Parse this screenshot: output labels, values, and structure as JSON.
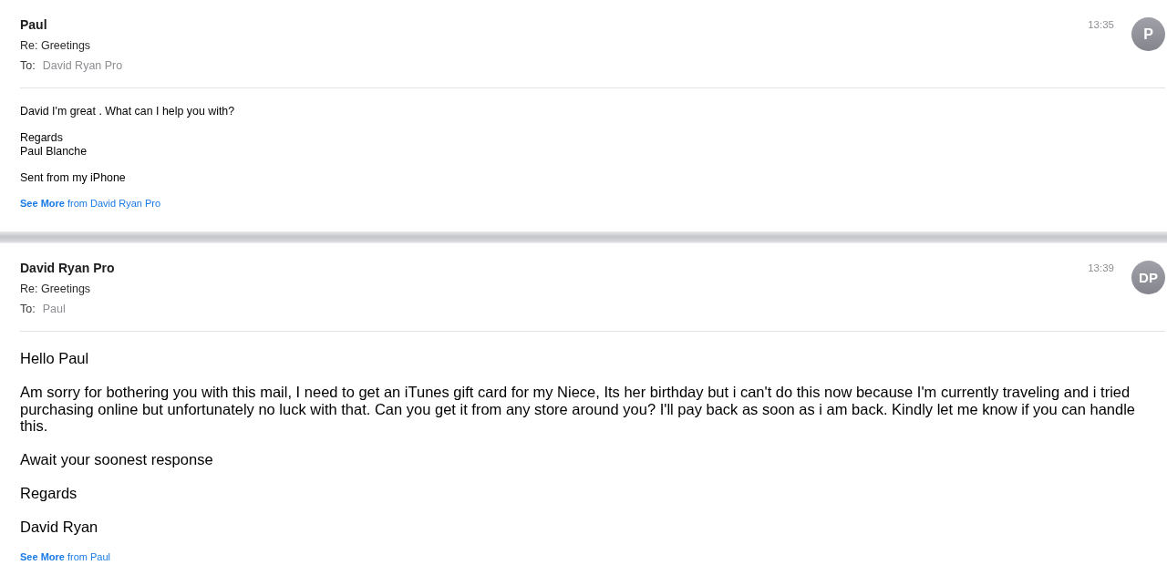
{
  "messages": [
    {
      "kind": "reply",
      "sender": "Paul",
      "subject": "Re: Greetings",
      "to_label": "To:",
      "recipient": "David Ryan Pro",
      "time": "13:35",
      "avatar_initials": "P",
      "body": [
        [
          "David I'm great . What can I help you with?"
        ],
        [
          "Regards",
          "Paul Blanche"
        ],
        [
          "Sent from my iPhone"
        ]
      ],
      "see_more": "**See More** from David Ryan Pro"
    },
    {
      "kind": "original",
      "sender": "David Ryan Pro",
      "subject": "Re: Greetings",
      "to_label": "To:",
      "recipient": "Paul",
      "time": "13:39",
      "avatar_initials": "DP",
      "body": [
        [
          "Hello Paul"
        ],
        [
          "Am sorry for bothering you with this mail, I need to get an iTunes gift card for my Niece, Its her birthday but i can't do this now because I'm currently traveling and i tried purchasing online but unfortunately no luck with that. Can you get it from any store around you? I'll pay back as soon as i am back. Kindly let me know if you can handle this."
        ],
        [
          "Await your soonest response"
        ],
        [
          "Regards"
        ],
        [
          "David Ryan"
        ]
      ],
      "see_more": "**See More** from Paul"
    }
  ]
}
